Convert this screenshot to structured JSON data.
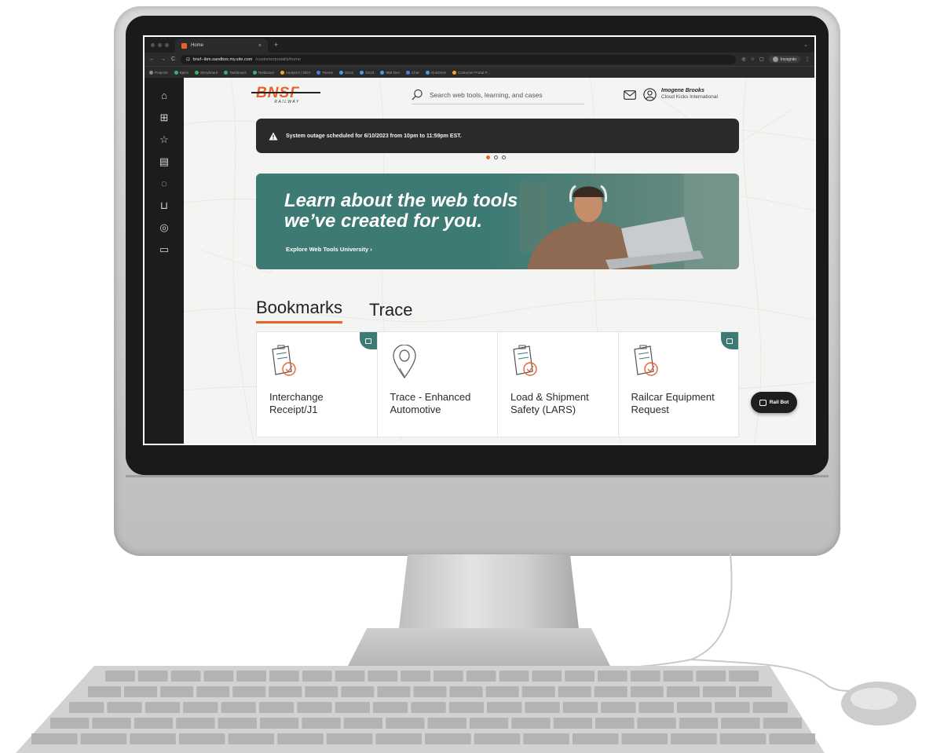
{
  "browser": {
    "tab_title": "Home",
    "tab_close": "×",
    "tab_new": "+",
    "url_host": "bnsf--ibm.sandbox.my.site.com",
    "url_path": "/customerportal/s/home",
    "incognito_label": "Incognito",
    "bookmarks": [
      {
        "label": "Projects",
        "color": "#8a8a8a"
      },
      {
        "label": "Epics",
        "color": "#37b26c"
      },
      {
        "label": "Storyboard",
        "color": "#37b26c"
      },
      {
        "label": "Taskboard",
        "color": "#37b26c"
      },
      {
        "label": "Testboard",
        "color": "#37b26c"
      },
      {
        "label": "Analytics | DEV",
        "color": "#f0a830"
      },
      {
        "label": "Teams",
        "color": "#4a7fe0"
      },
      {
        "label": "SS22",
        "color": "#4a9be0"
      },
      {
        "label": "SS23",
        "color": "#4a9be0"
      },
      {
        "label": "IBM Dev",
        "color": "#4a9be0"
      },
      {
        "label": "Chat",
        "color": "#4a7fe0"
      },
      {
        "label": "OneDrive",
        "color": "#4a9be0"
      },
      {
        "label": "Customer Portal P...",
        "color": "#f0a830"
      }
    ]
  },
  "sidebar": {
    "items": [
      {
        "name": "home-icon",
        "glyph": "⌂"
      },
      {
        "name": "grid-icon",
        "glyph": "⊞"
      },
      {
        "name": "star-icon",
        "glyph": "☆"
      },
      {
        "name": "document-icon",
        "glyph": "▤"
      },
      {
        "name": "cycle-icon",
        "glyph": "◌"
      },
      {
        "name": "inbox-icon",
        "glyph": "⊔"
      },
      {
        "name": "support-icon",
        "glyph": "◎"
      },
      {
        "name": "folder-icon",
        "glyph": "▭"
      }
    ]
  },
  "header": {
    "logo_text": "BNSF",
    "logo_subtext": "RAILWAY",
    "search_placeholder": "Search web tools, learning, and cases",
    "user_name": "Imogene Brooks",
    "user_org": "Cloud Kicks International"
  },
  "alert": {
    "text": "System outage scheduled for 6/10/2023 from 10pm to 11:59pm EST."
  },
  "hero": {
    "title_line1": "Learn about the web tools",
    "title_line2": "we’ve created for you.",
    "link": "Explore Web Tools University  ›"
  },
  "tabs": [
    {
      "label": "Bookmarks",
      "active": true
    },
    {
      "label": "Trace",
      "active": false
    }
  ],
  "cards": [
    {
      "label": "Interchange Receipt/J1",
      "badge": true,
      "icon": "clipboard-icon"
    },
    {
      "label": "Trace - Enhanced Automotive",
      "badge": false,
      "icon": "location-pin-icon"
    },
    {
      "label": "Load & Shipment Safety (LARS)",
      "badge": false,
      "icon": "clipboard-icon"
    },
    {
      "label": "Railcar Equipment Request",
      "badge": true,
      "icon": "clipboard-icon"
    }
  ],
  "railbot": {
    "label": "Rail Bot"
  },
  "colors": {
    "accent": "#e8632b",
    "teal": "#3d7a74",
    "dark": "#2a2a28"
  }
}
